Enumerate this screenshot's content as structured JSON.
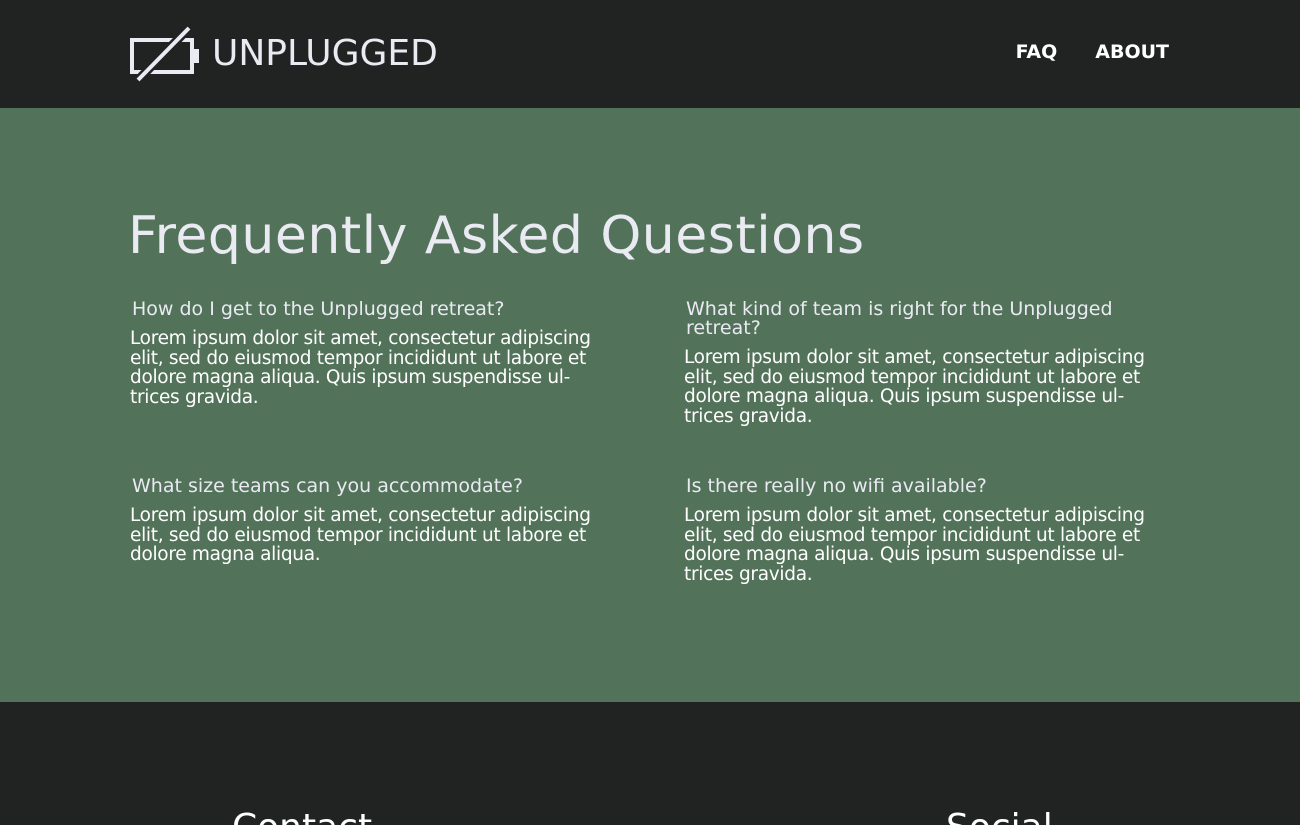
{
  "header": {
    "logo_text": "UNPLUGGED",
    "logo_icon": "battery-off-icon",
    "nav": [
      {
        "label": "FAQ"
      },
      {
        "label": "ABOUT"
      }
    ]
  },
  "faq": {
    "title": "Frequently Asked Questions",
    "items": [
      {
        "question": "How do I get to the Unplugged retreat?",
        "answer": "Lorem ipsum dolor sit amet, consectetur adipiscing elit, sed do eiusmod tempor incididunt ut labore et dolore magna aliqua. Quis ipsum suspendisse ul- trices gravida."
      },
      {
        "question": "What kind of team is right for the Unplugged retreat?",
        "answer": "Lorem ipsum dolor sit amet, consectetur adipiscing elit, sed do eiusmod tempor incididunt ut labore et dolore magna aliqua. Quis ipsum suspendisse ul- trices gravida."
      },
      {
        "question": "What size teams can you accommodate?",
        "answer": "Lorem ipsum dolor sit amet, consectetur adipiscing elit, sed do eiusmod tempor incididunt ut labore et dolore magna aliqua."
      },
      {
        "question": "Is there really no wifi available?",
        "answer": "Lorem ipsum dolor sit amet, consectetur adipiscing elit, sed do eiusmod tempor incididunt ut labore et dolore magna aliqua. Quis ipsum suspendisse ul- trices gravida."
      }
    ]
  },
  "footer": {
    "contact_heading": "Contact",
    "social_heading": "Social"
  },
  "colors": {
    "header_bg": "#212222",
    "faq_bg": "#53725a",
    "heading_text": "#e9eaf2",
    "body_text": "#ffffff"
  }
}
